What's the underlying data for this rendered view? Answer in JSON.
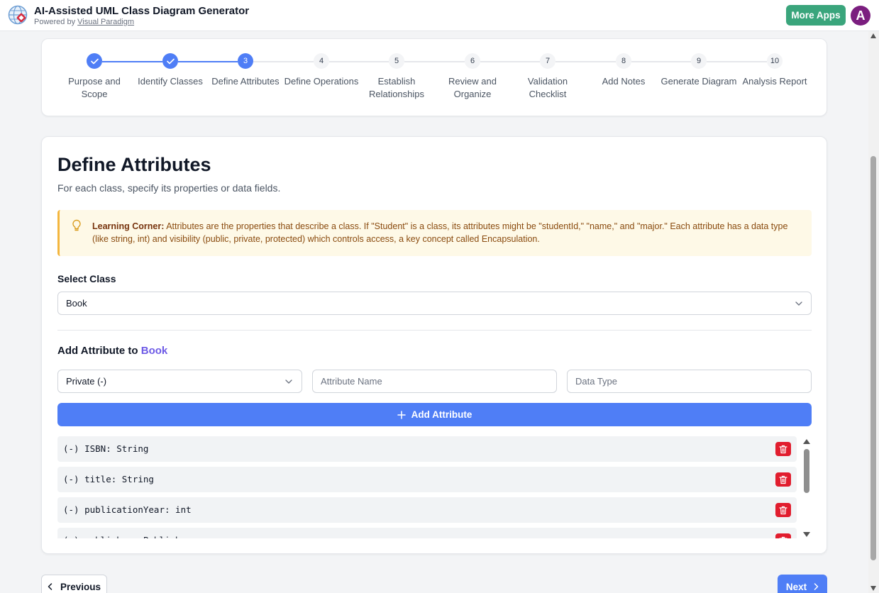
{
  "header": {
    "title": "AI-Assisted UML Class Diagram Generator",
    "powered_prefix": "Powered by",
    "powered_link": "Visual Paradigm",
    "more_apps": "More Apps",
    "avatar_initial": "A"
  },
  "stepper": {
    "steps": [
      {
        "num": "1",
        "label": "Purpose and Scope",
        "state": "done"
      },
      {
        "num": "2",
        "label": "Identify Classes",
        "state": "done"
      },
      {
        "num": "3",
        "label": "Define Attributes",
        "state": "active"
      },
      {
        "num": "4",
        "label": "Define Operations",
        "state": "todo"
      },
      {
        "num": "5",
        "label": "Establish Relationships",
        "state": "todo"
      },
      {
        "num": "6",
        "label": "Review and Organize",
        "state": "todo"
      },
      {
        "num": "7",
        "label": "Validation Checklist",
        "state": "todo"
      },
      {
        "num": "8",
        "label": "Add Notes",
        "state": "todo"
      },
      {
        "num": "9",
        "label": "Generate Diagram",
        "state": "todo"
      },
      {
        "num": "10",
        "label": "Analysis Report",
        "state": "todo"
      }
    ]
  },
  "main": {
    "title": "Define Attributes",
    "subtitle": "For each class, specify its properties or data fields.",
    "learning_label": "Learning Corner:",
    "learning_text": " Attributes are the properties that describe a class. If \"Student\" is a class, its attributes might be \"studentId,\" \"name,\" and \"major.\" Each attribute has a data type (like string, int) and visibility (public, private, protected) which controls access, a key concept called Encapsulation.",
    "select_class_label": "Select Class",
    "selected_class": "Book",
    "add_heading_prefix": "Add Attribute to",
    "add_heading_class": "Book",
    "visibility_value": "Private (-)",
    "attr_name_placeholder": "Attribute Name",
    "data_type_placeholder": "Data Type",
    "add_button": "Add Attribute",
    "attributes": [
      "(-) ISBN: String",
      "(-) title: String",
      "(-) publicationYear: int",
      "(-) publisher: Publisher"
    ]
  },
  "footer": {
    "previous": "Previous",
    "next": "Next"
  },
  "colors": {
    "primary": "#4f7ef6",
    "green": "#3aa57c",
    "avatar": "#7b1e7f",
    "danger": "#e11d2e",
    "learning_bg": "#fef9e7",
    "learning_border": "#f4b63f",
    "class_accent": "#6d5ae6"
  }
}
